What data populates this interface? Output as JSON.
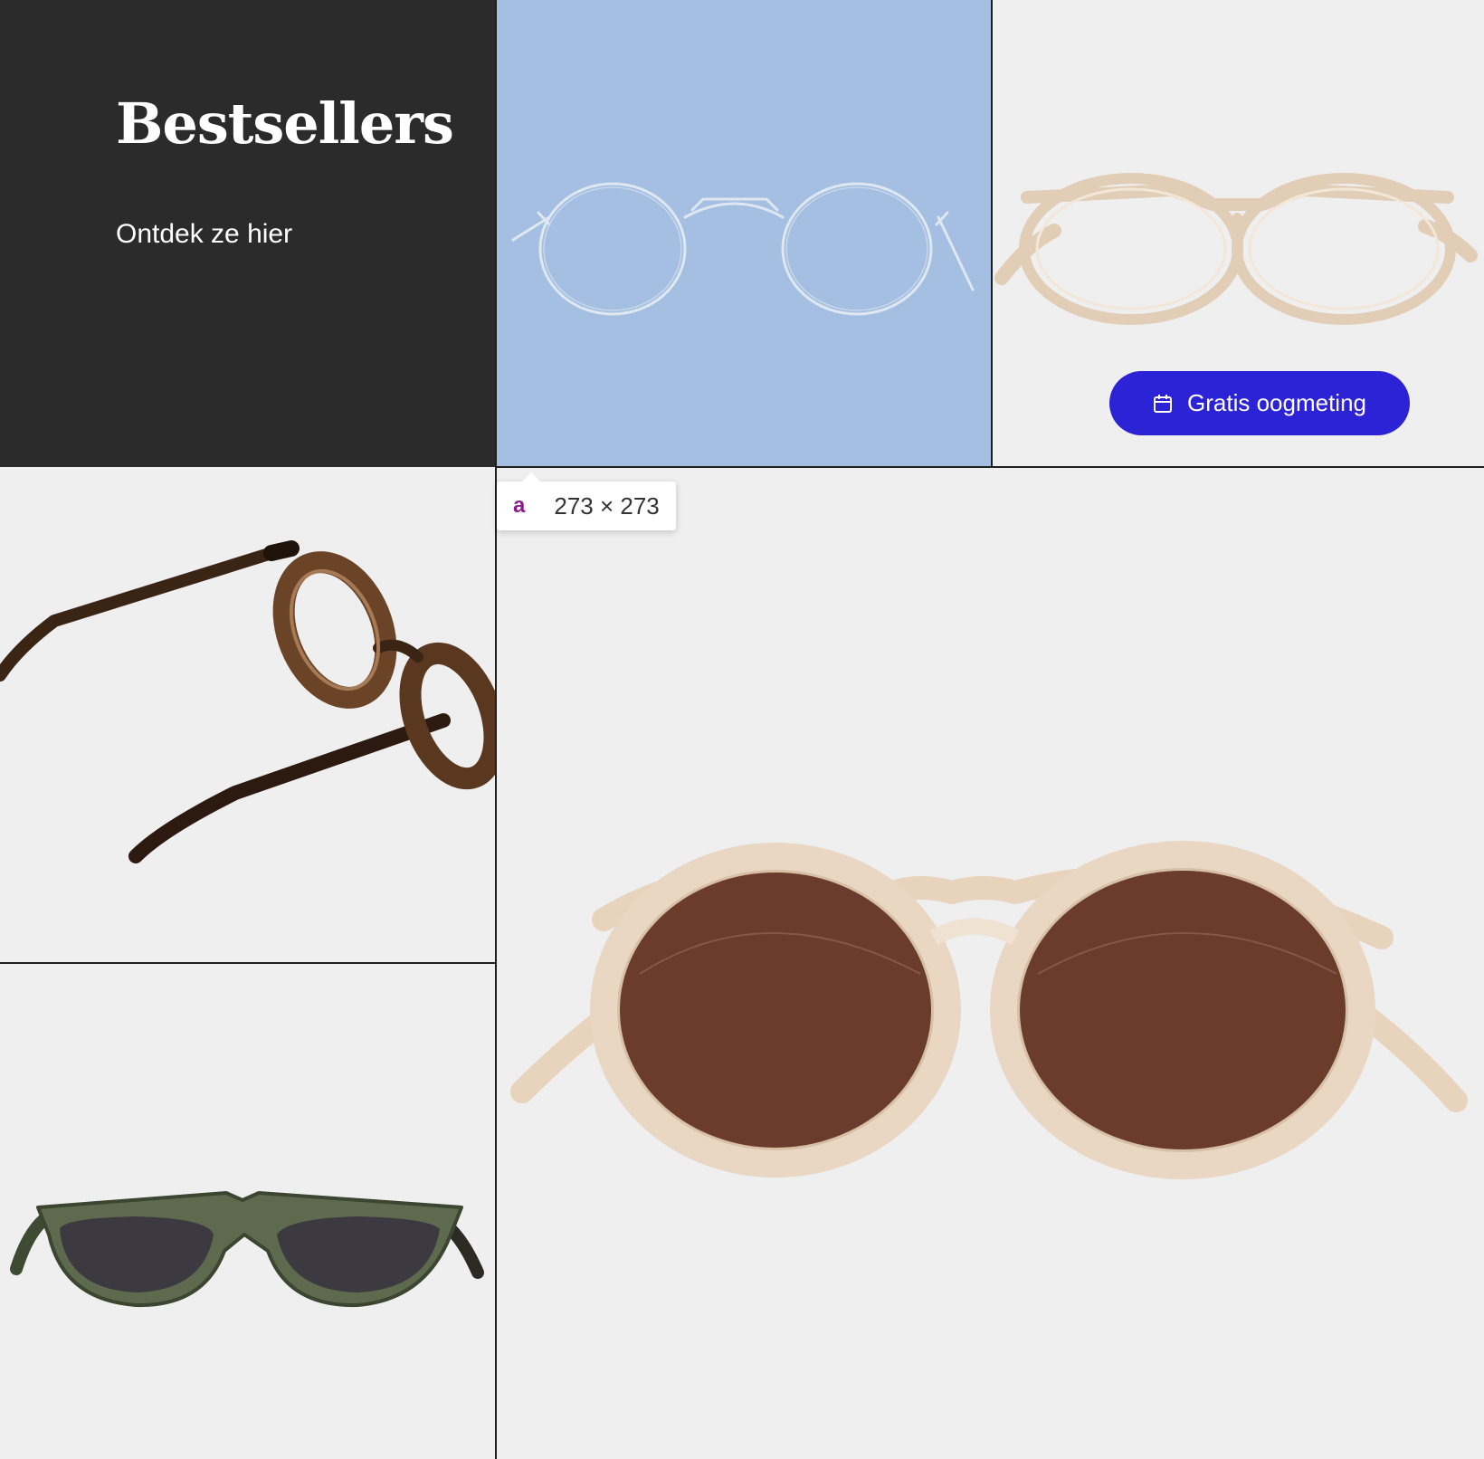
{
  "hero": {
    "title": "Bestsellers",
    "link_label": "Ontdek ze hier"
  },
  "cta": {
    "label": "Gratis oogmeting",
    "icon": "calendar-icon",
    "color": "#2c22d6"
  },
  "tooltip": {
    "tag": "a",
    "dimensions": "273 × 273"
  },
  "products": [
    {
      "name": "silver-metal-round-glasses",
      "background": "#a4bfe1"
    },
    {
      "name": "clear-champagne-glasses",
      "background": "#efefef"
    },
    {
      "name": "tortoise-round-glasses",
      "background": "#efefef"
    },
    {
      "name": "green-tortoise-sunglasses",
      "background": "#efefef"
    },
    {
      "name": "champagne-brown-sunglasses",
      "background": "#efefef"
    }
  ],
  "colors": {
    "hero_background": "#2b2b2c",
    "blue_tile": "#a4bfe1",
    "tile_background": "#efefef"
  }
}
